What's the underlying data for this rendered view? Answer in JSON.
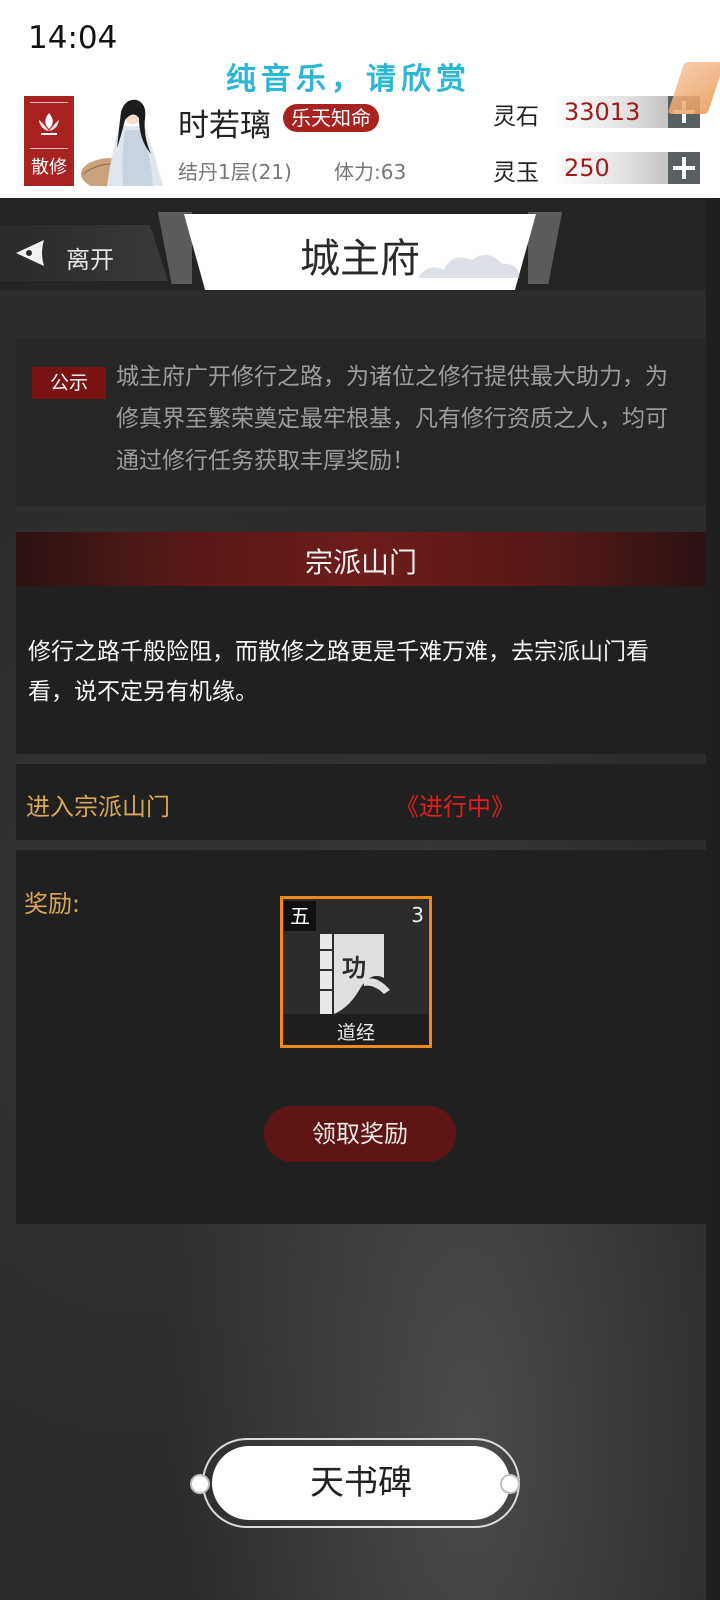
{
  "status_bar": {
    "time": "14:04"
  },
  "banner_text": "纯音乐，请欣赏",
  "player": {
    "sect_label": "散修",
    "name": "时若璃",
    "title": "乐天知命",
    "realm": "结丹1层(21)",
    "stamina": "体力:63"
  },
  "resources": [
    {
      "label": "灵石",
      "value": "33013"
    },
    {
      "label": "灵玉",
      "value": "250"
    }
  ],
  "nav": {
    "leave_label": "离开",
    "page_title": "城主府"
  },
  "notice": {
    "tag": "公示",
    "text": "城主府广开修行之路，为诸位之修行提供最大助力，为修真界至繁荣奠定最牢根基，凡有修行资质之人，均可通过修行任务获取丰厚奖励！"
  },
  "quest": {
    "title": "宗派山门",
    "description": "修行之路千般险阻，而散修之路更是千难万难，去宗派山门看看，说不定另有机缘。"
  },
  "task": {
    "name": "进入宗派山门",
    "status": "《进行中》"
  },
  "reward": {
    "label": "奖励:",
    "item": {
      "grade": "五",
      "count": "3",
      "art_glyph": "功",
      "name": "道经"
    },
    "claim_label": "领取奖励"
  },
  "bottom_button": {
    "label": "天书碑"
  },
  "colors": {
    "accent_red": "#a8231f",
    "gold_text": "#d8a75a",
    "status_red": "#e11e1e",
    "item_border": "#f08a1c",
    "banner_cyan": "#2ab6d4"
  }
}
